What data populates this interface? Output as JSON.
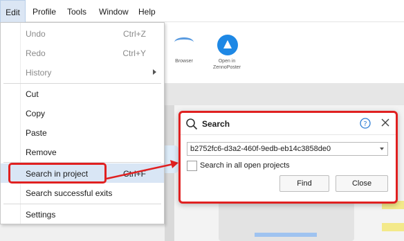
{
  "menubar": {
    "items": [
      "Edit",
      "Profile",
      "Tools",
      "Window",
      "Help"
    ]
  },
  "toolbar_bg": {
    "buttons": [
      {
        "label": "Browser",
        "icon": "wifi-icon"
      },
      {
        "label": "Open in ZennoPoster",
        "icon": "zennoposter-icon"
      }
    ]
  },
  "edit_menu": {
    "items": [
      {
        "label": "Undo",
        "shortcut": "Ctrl+Z",
        "disabled": true
      },
      {
        "label": "Redo",
        "shortcut": "Ctrl+Y",
        "disabled": true
      },
      {
        "label": "History",
        "shortcut": "",
        "disabled": true,
        "submenu": true
      },
      {
        "label": "Cut",
        "shortcut": ""
      },
      {
        "label": "Copy",
        "shortcut": ""
      },
      {
        "label": "Paste",
        "shortcut": ""
      },
      {
        "label": "Remove",
        "shortcut": ""
      },
      {
        "label": "Search in project",
        "shortcut": "Ctrl+F",
        "highlighted": true
      },
      {
        "label": "Search successful exits",
        "shortcut": ""
      },
      {
        "label": "Settings",
        "shortcut": ""
      }
    ]
  },
  "search_dialog": {
    "title": "Search",
    "query": "b2752fc6-d3a2-460f-9edb-eb14c3858de0",
    "search_all_label": "Search in all open projects",
    "search_all_checked": false,
    "find_label": "Find",
    "close_label": "Close"
  },
  "colors": {
    "annotation": "#e02020",
    "highlight": "#d9e6f5",
    "accent": "#1e88e5"
  }
}
